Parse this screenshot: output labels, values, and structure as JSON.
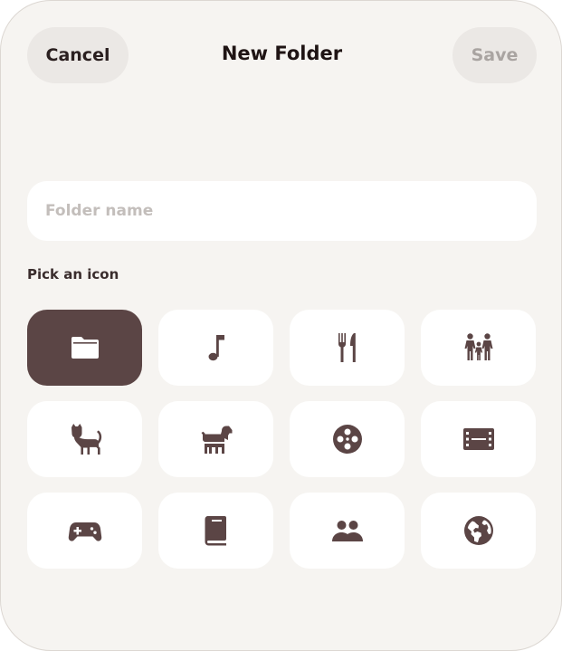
{
  "header": {
    "cancel_label": "Cancel",
    "title": "New Folder",
    "save_label": "Save"
  },
  "folder_name": {
    "value": "",
    "placeholder": "Folder name"
  },
  "icon_picker": {
    "label": "Pick an icon",
    "selected_index": 0,
    "icons": [
      "folder-icon",
      "music-note-icon",
      "fork-knife-icon",
      "family-icon",
      "cat-icon",
      "dog-icon",
      "film-reel-icon",
      "film-strip-icon",
      "gamepad-icon",
      "book-icon",
      "people-icon",
      "globe-icon"
    ]
  },
  "colors": {
    "background": "#f6f4f1",
    "accent": "#5b4545",
    "button_bg": "#ebe8e5",
    "disabled_text": "#a9a4a1"
  }
}
